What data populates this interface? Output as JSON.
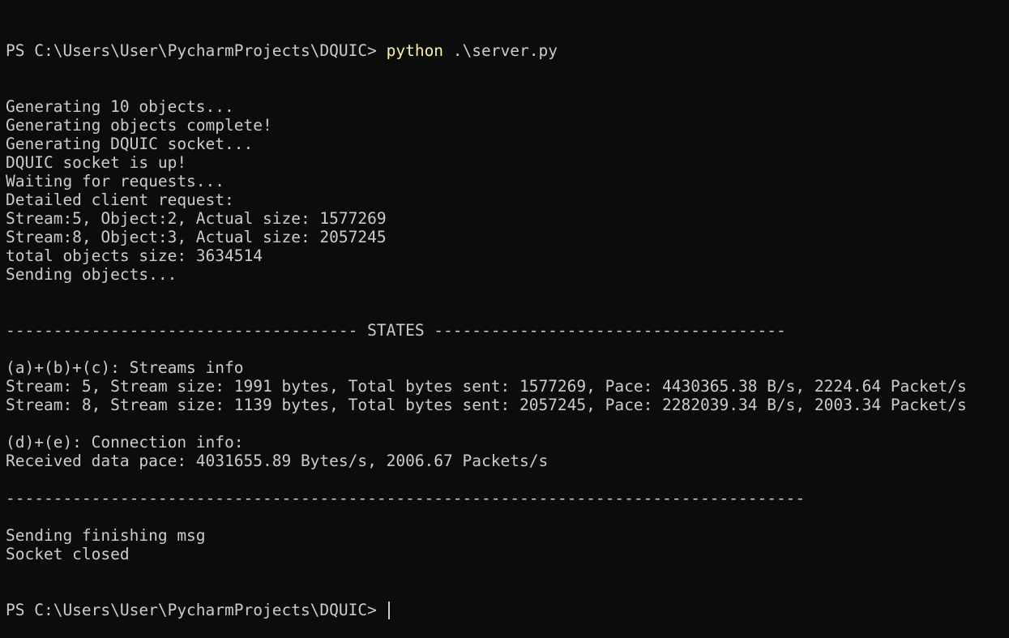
{
  "terminal": {
    "prompt": "PS C:\\Users\\User\\PycharmProjects\\DQUIC> ",
    "command": "python",
    "command_args": " .\\server.py",
    "lines": [
      "Generating 10 objects...",
      "Generating objects complete!",
      "Generating DQUIC socket...",
      "DQUIC socket is up!",
      "Waiting for requests...",
      "Detailed client request:",
      "Stream:5, Object:2, Actual size: 1577269",
      "Stream:8, Object:3, Actual size: 2057245",
      "total objects size: 3634514",
      "Sending objects...",
      "",
      "",
      "------------------------------------- STATES -------------------------------------",
      "",
      "(a)+(b)+(c): Streams info",
      "Stream: 5, Stream size: 1991 bytes, Total bytes sent: 1577269, Pace: 4430365.38 B/s, 2224.64 Packet/s",
      "Stream: 8, Stream size: 1139 bytes, Total bytes sent: 2057245, Pace: 2282039.34 B/s, 2003.34 Packet/s",
      "",
      "(d)+(e): Connection info:",
      "Received data pace: 4031655.89 Bytes/s, 2006.67 Packets/s",
      "",
      "------------------------------------------------------------------------------------",
      "",
      "Sending finishing msg",
      "Socket closed"
    ],
    "final_prompt": "PS C:\\Users\\User\\PycharmProjects\\DQUIC> "
  },
  "colors": {
    "background": "#0c0c0c",
    "text": "#cccccc",
    "command": "#f9f1a5"
  }
}
